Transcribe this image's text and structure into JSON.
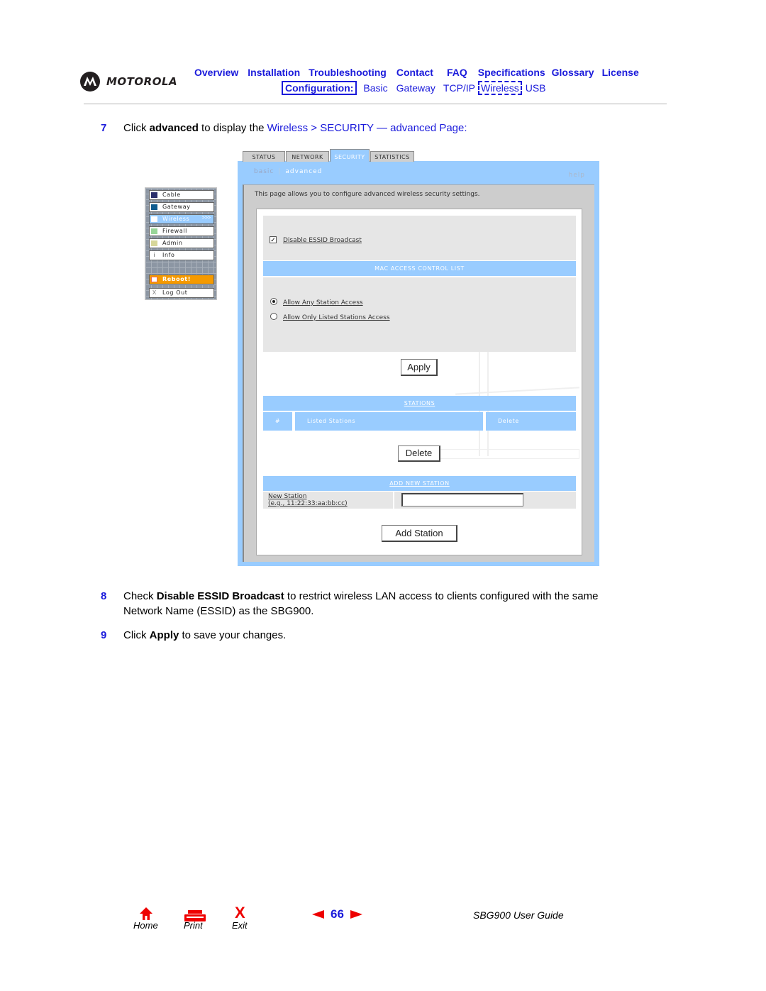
{
  "header": {
    "brand": "MOTOROLA",
    "nav_top": [
      "Overview",
      "Installation",
      "Troubleshooting",
      "Contact",
      "FAQ",
      "Specifications",
      "Glossary",
      "License"
    ],
    "nav_sub": {
      "label": "Configuration:",
      "items": [
        "Basic",
        "Gateway",
        "TCP/IP",
        "Wireless",
        "USB"
      ],
      "current": "Wireless"
    }
  },
  "steps": {
    "s7": {
      "num": "7",
      "pre": "Click ",
      "bold": "advanced",
      "mid": " to display the ",
      "link": "Wireless > SECURITY — advanced Page",
      "post": ":"
    },
    "s8": {
      "num": "8",
      "pre": "Check ",
      "bold": "Disable ESSID Broadcast",
      "post": " to restrict wireless LAN access to clients configured with the same",
      "line2": "Network Name (ESSID) as the SBG900."
    },
    "s9": {
      "num": "9",
      "pre": "Click ",
      "bold": "Apply",
      "post": " to save your changes."
    }
  },
  "ui": {
    "tabs": [
      "STATUS",
      "NETWORK",
      "SECURITY",
      "STATISTICS"
    ],
    "active_tab": "SECURITY",
    "subnav": {
      "basic": "basic",
      "separator": "|",
      "advanced": "advanced",
      "active": "advanced"
    },
    "help": "help",
    "description": "This page allows you to configure advanced wireless security settings.",
    "disable_essid": {
      "label": "Disable ESSID Broadcast",
      "checked": true
    },
    "mac_acl_title": "MAC ACCESS CONTROL LIST",
    "radio_options": [
      {
        "label": "Allow Any Station Access",
        "selected": true
      },
      {
        "label": "Allow Only Listed Stations Access",
        "selected": false
      }
    ],
    "apply_button": "Apply",
    "stations_title": "STATIONS",
    "stations_columns": [
      "#",
      "Listed Stations",
      "Delete"
    ],
    "delete_button": "Delete",
    "add_new_station_title": "ADD NEW STATION",
    "new_station_label": "New Station",
    "new_station_hint": "(e.g., 11:22:33:aa:bb:cc)",
    "new_station_value": "",
    "add_station_button": "Add Station",
    "sidenav": [
      {
        "label": "Cable",
        "color": "#2b2f6b"
      },
      {
        "label": "Gateway",
        "color": "#0f5c8f"
      },
      {
        "label": "Wireless",
        "color": "#ffffff",
        "active": true,
        "arrow": ">>>"
      },
      {
        "label": "Firewall",
        "color": "#99d699"
      },
      {
        "label": "Admin",
        "color": "#d6d699"
      },
      {
        "label": "Info",
        "icon": "i"
      },
      {
        "label": "Reboot!",
        "icon": "reboot"
      },
      {
        "label": "Log Out",
        "icon": "X"
      }
    ]
  },
  "footer": {
    "home": "Home",
    "print": "Print",
    "exit": "Exit",
    "exit_glyph": "X",
    "page_number": "66",
    "guide_title": "SBG900 User Guide"
  }
}
